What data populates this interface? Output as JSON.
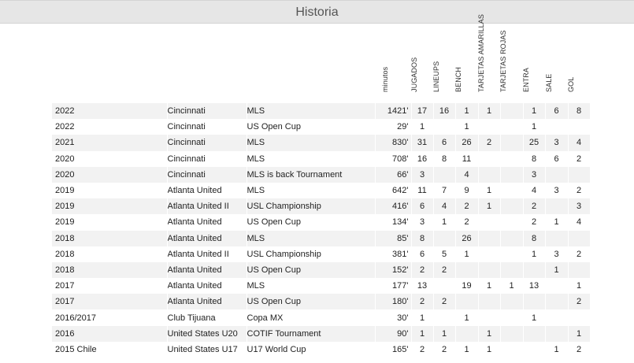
{
  "title": "Historia",
  "columns": {
    "minutos": "minutos",
    "jugados": "JUGADOS",
    "lineups": "LINEUPS",
    "bench": "BENCH",
    "amarillas": "TARJETAS AMARILLAS",
    "rojas": "TARJETAS ROJAS",
    "entra": "ENTRA",
    "sale": "SALE",
    "gol": "GOL"
  },
  "rows": [
    {
      "year": "2022",
      "team": "Cincinnati",
      "comp": "MLS",
      "min": "1421'",
      "jug": "17",
      "lin": "16",
      "ben": "1",
      "ama": "1",
      "roj": "",
      "ent": "1",
      "sal": "6",
      "gol": "8"
    },
    {
      "year": "2022",
      "team": "Cincinnati",
      "comp": "US Open Cup",
      "min": "29'",
      "jug": "1",
      "lin": "",
      "ben": "1",
      "ama": "",
      "roj": "",
      "ent": "1",
      "sal": "",
      "gol": ""
    },
    {
      "year": "2021",
      "team": "Cincinnati",
      "comp": "MLS",
      "min": "830'",
      "jug": "31",
      "lin": "6",
      "ben": "26",
      "ama": "2",
      "roj": "",
      "ent": "25",
      "sal": "3",
      "gol": "4"
    },
    {
      "year": "2020",
      "team": "Cincinnati",
      "comp": "MLS",
      "min": "708'",
      "jug": "16",
      "lin": "8",
      "ben": "11",
      "ama": "",
      "roj": "",
      "ent": "8",
      "sal": "6",
      "gol": "2"
    },
    {
      "year": "2020",
      "team": "Cincinnati",
      "comp": "MLS is back Tournament",
      "min": "66'",
      "jug": "3",
      "lin": "",
      "ben": "4",
      "ama": "",
      "roj": "",
      "ent": "3",
      "sal": "",
      "gol": ""
    },
    {
      "year": "2019",
      "team": "Atlanta United",
      "comp": "MLS",
      "min": "642'",
      "jug": "11",
      "lin": "7",
      "ben": "9",
      "ama": "1",
      "roj": "",
      "ent": "4",
      "sal": "3",
      "gol": "2"
    },
    {
      "year": "2019",
      "team": "Atlanta United II",
      "comp": "USL Championship",
      "min": "416'",
      "jug": "6",
      "lin": "4",
      "ben": "2",
      "ama": "1",
      "roj": "",
      "ent": "2",
      "sal": "",
      "gol": "3"
    },
    {
      "year": "2019",
      "team": "Atlanta United",
      "comp": "US Open Cup",
      "min": "134'",
      "jug": "3",
      "lin": "1",
      "ben": "2",
      "ama": "",
      "roj": "",
      "ent": "2",
      "sal": "1",
      "gol": "4"
    },
    {
      "year": "2018",
      "team": "Atlanta United",
      "comp": "MLS",
      "min": "85'",
      "jug": "8",
      "lin": "",
      "ben": "26",
      "ama": "",
      "roj": "",
      "ent": "8",
      "sal": "",
      "gol": ""
    },
    {
      "year": "2018",
      "team": "Atlanta United II",
      "comp": "USL Championship",
      "min": "381'",
      "jug": "6",
      "lin": "5",
      "ben": "1",
      "ama": "",
      "roj": "",
      "ent": "1",
      "sal": "3",
      "gol": "2"
    },
    {
      "year": "2018",
      "team": "Atlanta United",
      "comp": "US Open Cup",
      "min": "152'",
      "jug": "2",
      "lin": "2",
      "ben": "",
      "ama": "",
      "roj": "",
      "ent": "",
      "sal": "1",
      "gol": ""
    },
    {
      "year": "2017",
      "team": "Atlanta United",
      "comp": "MLS",
      "min": "177'",
      "jug": "13",
      "lin": "",
      "ben": "19",
      "ama": "1",
      "roj": "1",
      "ent": "13",
      "sal": "",
      "gol": "1"
    },
    {
      "year": "2017",
      "team": "Atlanta United",
      "comp": "US Open Cup",
      "min": "180'",
      "jug": "2",
      "lin": "2",
      "ben": "",
      "ama": "",
      "roj": "",
      "ent": "",
      "sal": "",
      "gol": "2"
    },
    {
      "year": "2016/2017",
      "team": "Club Tijuana",
      "comp": "Copa MX",
      "min": "30'",
      "jug": "1",
      "lin": "",
      "ben": "1",
      "ama": "",
      "roj": "",
      "ent": "1",
      "sal": "",
      "gol": ""
    },
    {
      "year": "2016",
      "team": "United States U20",
      "comp": "COTIF Tournament",
      "min": "90'",
      "jug": "1",
      "lin": "1",
      "ben": "",
      "ama": "1",
      "roj": "",
      "ent": "",
      "sal": "",
      "gol": "1"
    },
    {
      "year": "2015 Chile",
      "team": "United States U17",
      "comp": "U17 World Cup",
      "min": "165'",
      "jug": "2",
      "lin": "2",
      "ben": "1",
      "ama": "1",
      "roj": "",
      "ent": "",
      "sal": "1",
      "gol": "2"
    }
  ]
}
